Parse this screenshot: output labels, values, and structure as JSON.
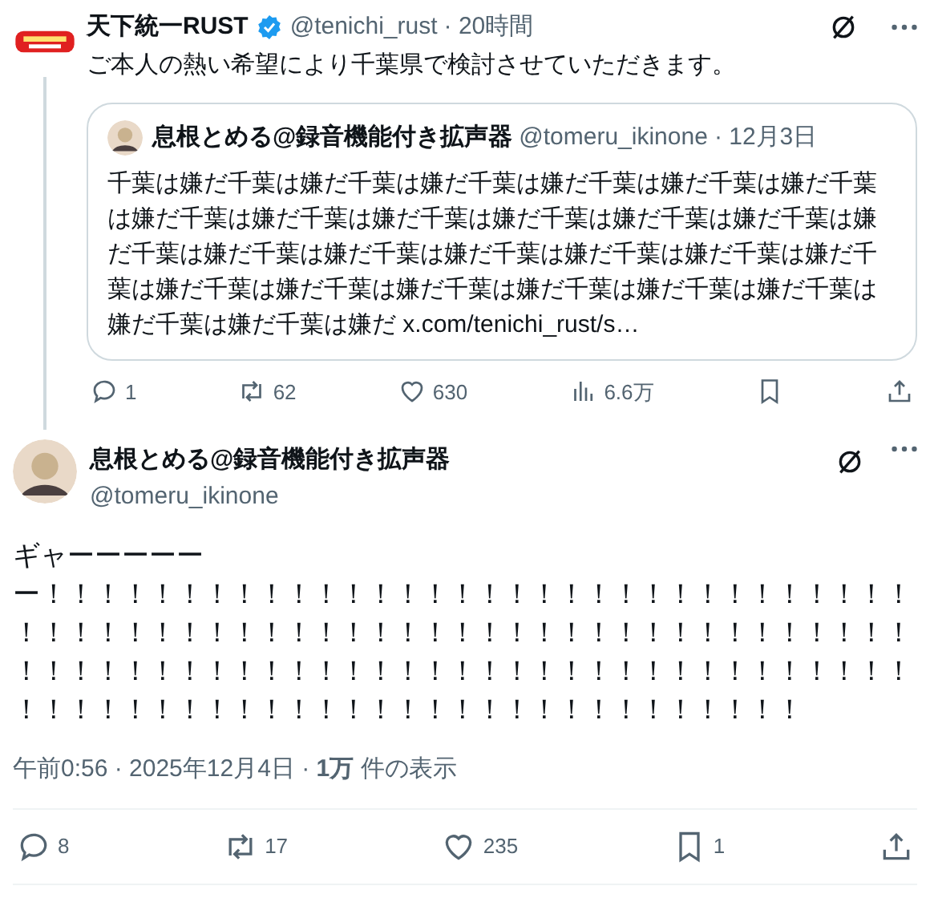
{
  "thread_post": {
    "name": "天下統一RUST",
    "verified": true,
    "handle": "@tenichi_rust",
    "time": "· 20時間",
    "text": "ご本人の熱い希望により千葉県で検討させていただきます。",
    "quote": {
      "name": "息根とめる@録音機能付き拡声器",
      "handle": "@tomeru_ikinone",
      "time": "· 12月3日",
      "text": "千葉は嫌だ千葉は嫌だ千葉は嫌だ千葉は嫌だ千葉は嫌だ千葉は嫌だ千葉は嫌だ千葉は嫌だ千葉は嫌だ千葉は嫌だ千葉は嫌だ千葉は嫌だ千葉は嫌だ千葉は嫌だ千葉は嫌だ千葉は嫌だ千葉は嫌だ千葉は嫌だ千葉は嫌だ千葉は嫌だ千葉は嫌だ千葉は嫌だ千葉は嫌だ千葉は嫌だ千葉は嫌だ千葉は嫌だ千葉は嫌だ千葉は嫌だ x.com/tenichi_rust/s…"
    },
    "actions": [
      {
        "kind": "reply",
        "count": "1"
      },
      {
        "kind": "repost",
        "count": "62"
      },
      {
        "kind": "like",
        "count": "630"
      },
      {
        "kind": "views",
        "count": "6.6万"
      },
      {
        "kind": "bookmark"
      },
      {
        "kind": "share"
      }
    ]
  },
  "main_post": {
    "name": "息根とめる@録音機能付き拡声器",
    "handle": "@tomeru_ikinone",
    "text_lines": [
      "ギャーーーーー",
      "ー！！！！！！！！！！！！！！！！！！！！！！！！！！！！！！！！！！！！！！！！！！！！！！！！！！！！！！！！！！！！！！！！！！！！！！！！！！！！！！！！！！！！！！！！！！！！！！！！！！！！！！！！！！！！！！！！！！！！！！！！！！！！！！！"
    ],
    "meta": "午前0:56 · 2025年12月4日 · **1万** 件の表示",
    "actions": [
      {
        "kind": "reply",
        "count": "8"
      },
      {
        "kind": "repost",
        "count": "17"
      },
      {
        "kind": "like",
        "count": "235"
      },
      {
        "kind": "bookmark",
        "count": "1"
      },
      {
        "kind": "share"
      }
    ]
  }
}
